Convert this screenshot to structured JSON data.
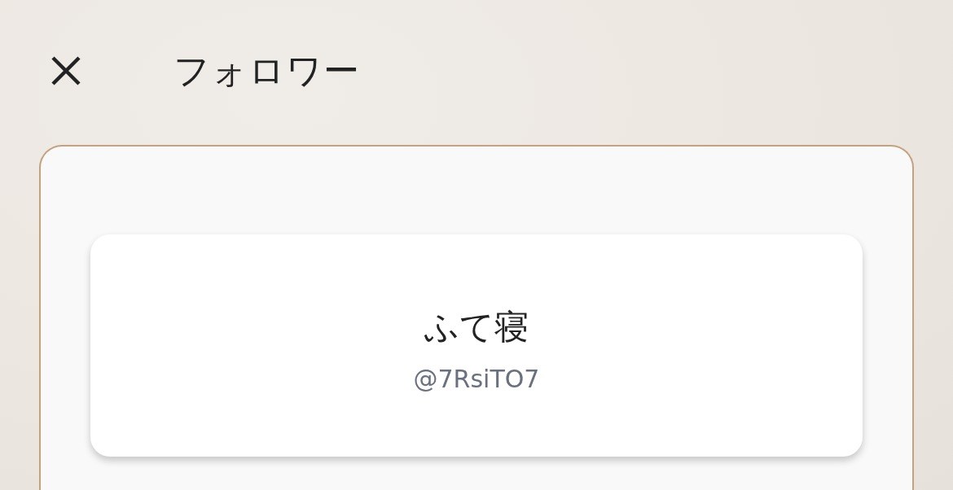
{
  "header": {
    "title": "フォロワー"
  },
  "followers": [
    {
      "name": "ふて寝",
      "handle": "@7RsiTO7"
    }
  ]
}
